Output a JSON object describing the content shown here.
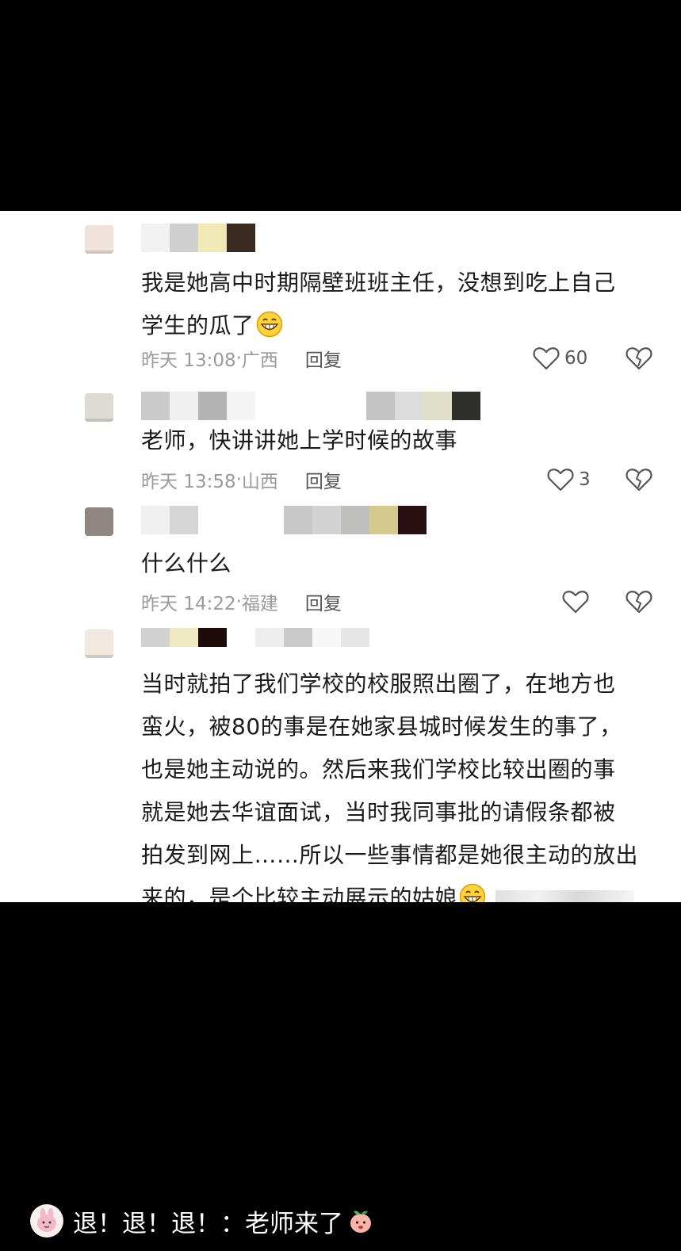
{
  "comments": [
    {
      "text_line1": "我是她高中时期隔壁班班主任，没想到吃上自己",
      "text_line2": "学生的瓜了",
      "emoji": "grinning-face-emoji",
      "time": "昨天 13:08",
      "location": "广西",
      "reply_label": "回复",
      "likes": "60"
    },
    {
      "text": "老师，快讲讲她上学时候的故事",
      "time": "昨天 13:58",
      "location": "山西",
      "reply_label": "回复",
      "likes": "3"
    },
    {
      "text": "什么什么",
      "time": "昨天 14:22",
      "location": "福建",
      "reply_label": "回复",
      "likes": ""
    },
    {
      "lines": [
        "当时就拍了我们学校的校服照出圈了，在地方也",
        "蛮火，被80的事是在她家县城时候发生的事了，",
        "也是她主动说的。然后来我们学校比较出圈的事",
        "就是她去华谊面试，当时我同事批的请假条都被",
        "拍发到网上……所以一些事情都是她很主动的放出",
        "来的，是个比较主动展示的姑娘"
      ],
      "emoji": "grinning-face-emoji"
    }
  ],
  "separator": "·",
  "footer": {
    "text": "退！退！退！：老师来了",
    "emoji": "peach-emoji"
  },
  "icons": [
    "heart-outline-icon",
    "broken-heart-icon"
  ],
  "colors": {
    "background": "#000000",
    "panel": "#ffffff",
    "text": "#1a1a1a",
    "meta": "#9a9a9a"
  }
}
